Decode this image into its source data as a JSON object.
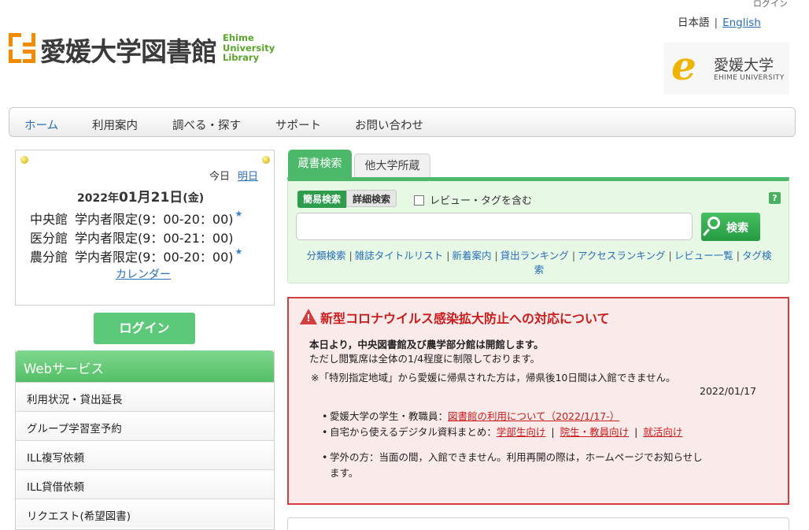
{
  "header": {
    "login_link": "ログイン",
    "lang_ja": "日本語",
    "lang_sep": "|",
    "lang_en": "English",
    "logo_mark": "EU Lib",
    "logo_title": "愛媛大学図書館",
    "logo_en_1": "Ehime",
    "logo_en_2": "University",
    "logo_en_3": "Library",
    "univ_mark": "e",
    "univ_name_ja": "愛媛大学",
    "univ_name_en": "EHIME UNIVERSITY"
  },
  "nav": {
    "items": [
      "ホーム",
      "利用案内",
      "調べる・探す",
      "サポート",
      "お問い合わせ"
    ]
  },
  "calendar": {
    "today_label": "今日",
    "tomorrow_label": "明日",
    "date_year": "2022年",
    "date_month_day": "01月21日",
    "date_weekday": "(金)",
    "rows": [
      {
        "library": "中央館",
        "hours": "学内者限定(9：00-20：00)",
        "star": "★"
      },
      {
        "library": "医分館",
        "hours": "学内者限定(9：00-21：00)",
        "star": ""
      },
      {
        "library": "農分館",
        "hours": "学内者限定(9：00-20：00)",
        "star": "★"
      }
    ],
    "calendar_link": "カレンダー"
  },
  "login_button": "ログイン",
  "web_service": {
    "title": "Webサービス",
    "items": [
      "利用状況・貸出延長",
      "グループ学習室予約",
      "ILL複写依頼",
      "ILL貸借依頼",
      "リクエスト(希望図書)"
    ]
  },
  "search": {
    "tab_active": "蔵書検索",
    "tab_other": "他大学所蔵",
    "mode_simple": "簡易検索",
    "mode_advanced": "詳細検索",
    "include_reviews": "レビュー・タグを含む",
    "help": "?",
    "input_value": "",
    "input_placeholder": "",
    "button": "検索",
    "links": [
      "分類検索",
      "雑誌タイトルリスト",
      "新着案内",
      "貸出ランキング",
      "アクセスランキング",
      "レビュー一覧",
      "タグ検索"
    ],
    "link_sep": "|"
  },
  "notice": {
    "title": "新型コロナウイルス感染拡大防止への対応について",
    "line1": "本日より，中央図書館及び農学部分館は開館します。",
    "line2": "ただし閲覧席は全体の1/4程度に制限しております。",
    "line3": "※「特別指定地域」から愛媛に帰県された方は，帰県後10日間は入館できません。",
    "date": "2022/01/17",
    "item1_text": "愛媛大学の学生・教職員：",
    "item1_link": "図書館の利用について（2022/1/17-）",
    "item2_text": "自宅から使えるデジタル資料まとめ：",
    "item2_links": [
      "学部生向け",
      "院生・教員向け",
      "就活向け"
    ],
    "item2_sep": "|",
    "item3_line1": "学外の方：当面の間，入館できません。利用再開の際は，ホームページでお知らせし",
    "item3_line2": "ます。"
  },
  "colors": {
    "accent_green": "#4cb86a",
    "link_blue": "#2a6ebb",
    "alert_red": "#d43d3d"
  }
}
